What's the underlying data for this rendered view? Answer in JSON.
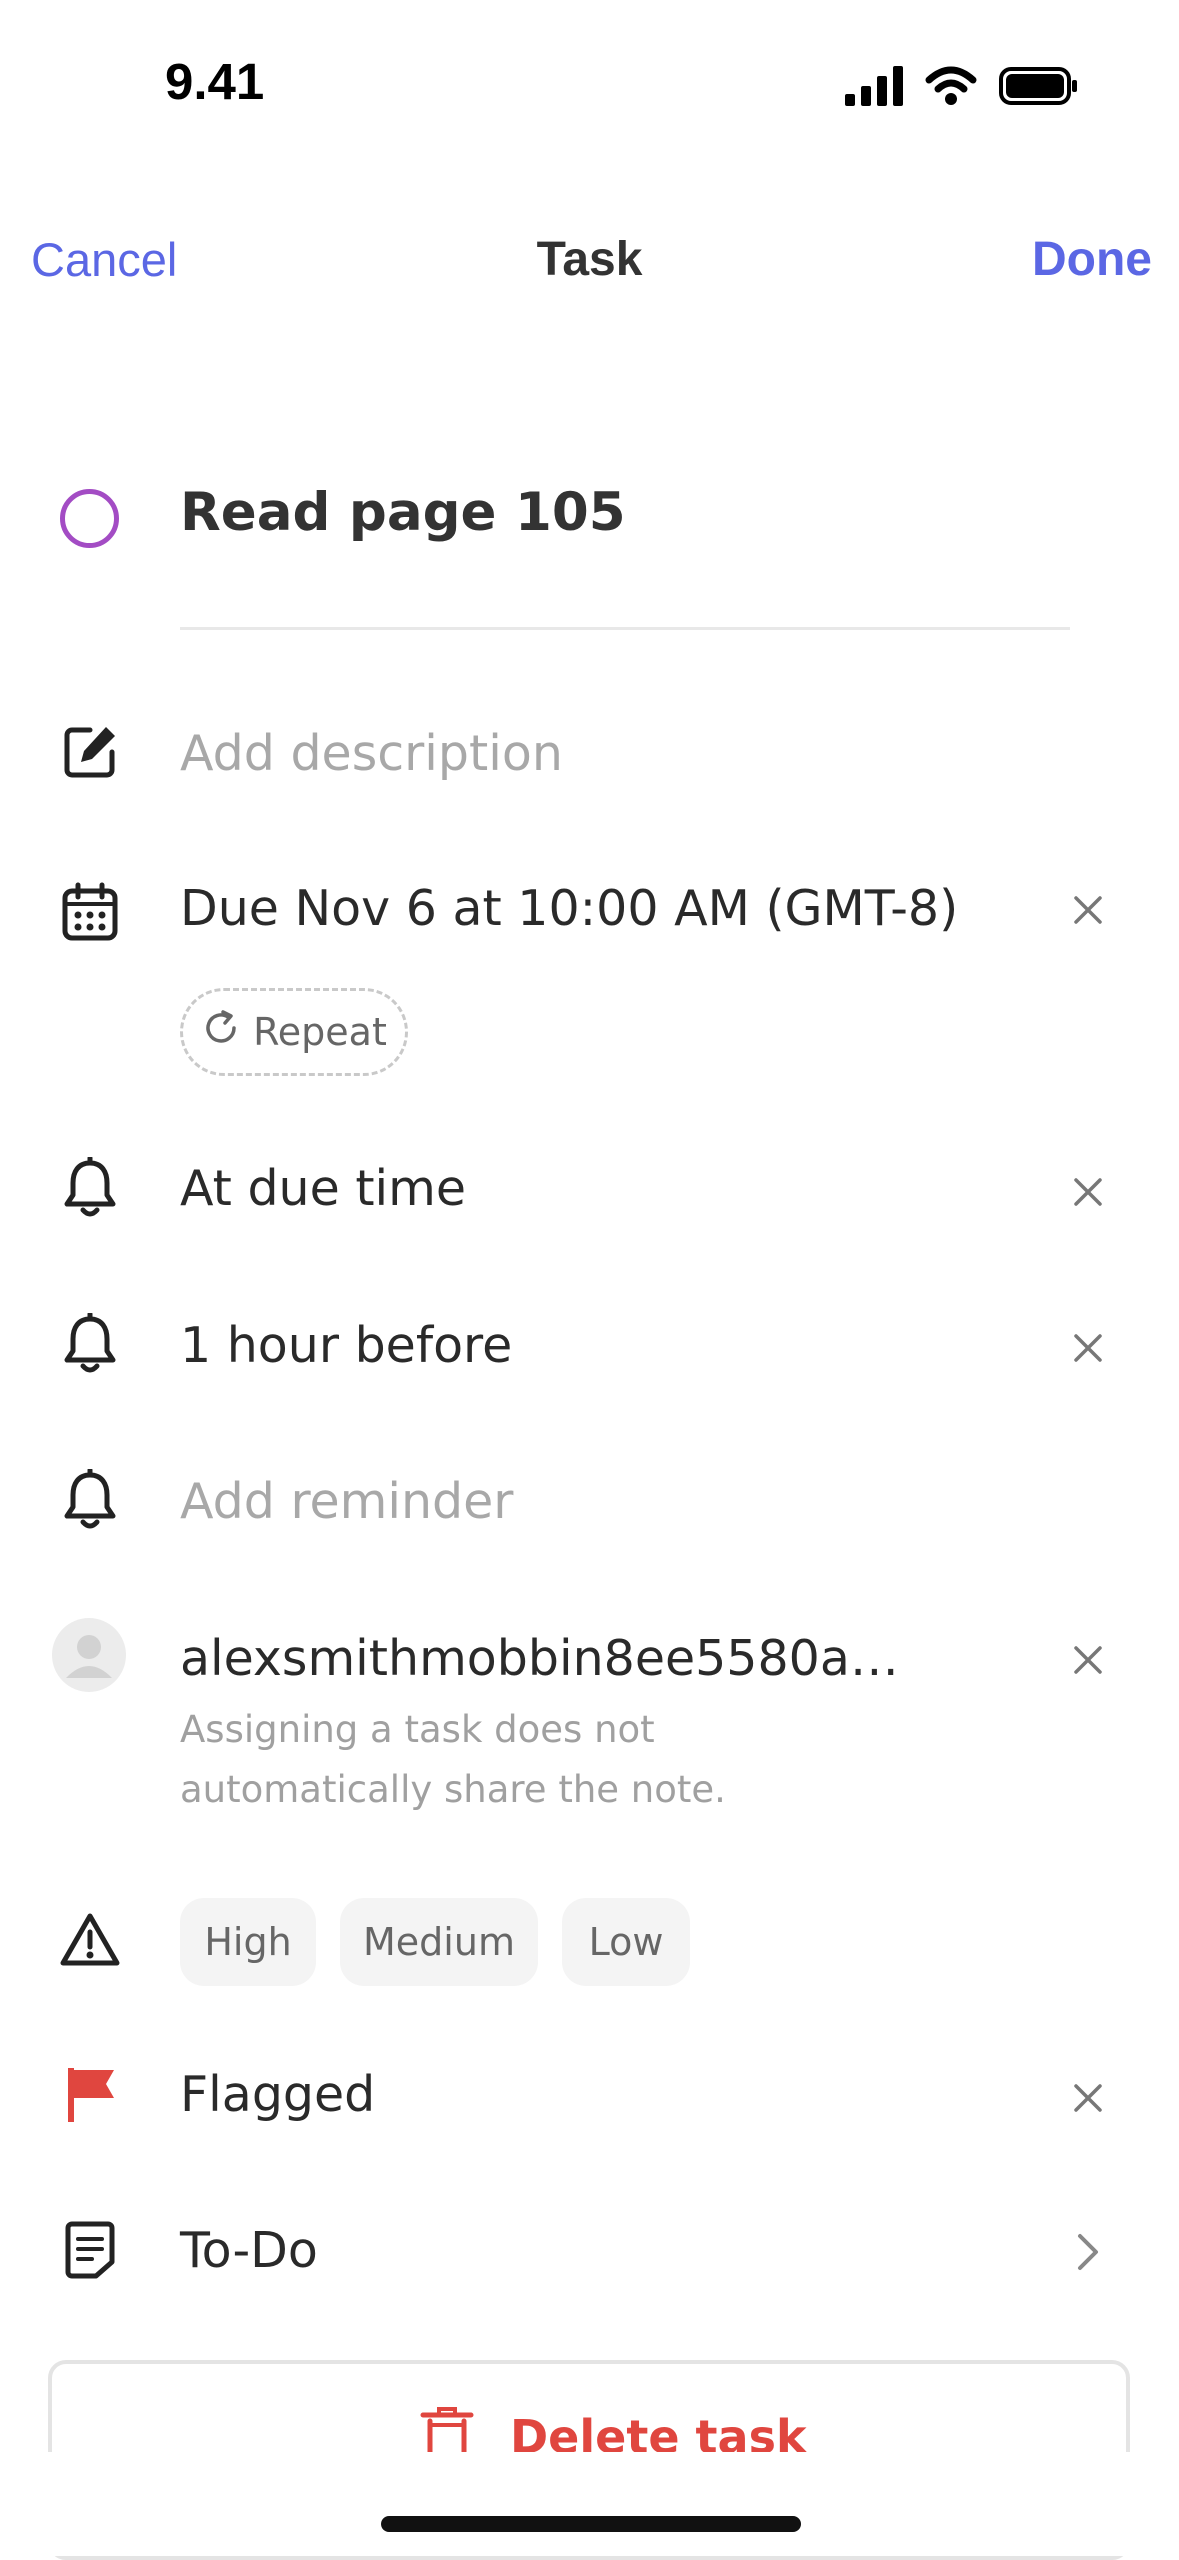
{
  "status_bar": {
    "time": "9.41"
  },
  "nav": {
    "cancel_label": "Cancel",
    "title": "Task",
    "done_label": "Done"
  },
  "task": {
    "title": "Read page 105",
    "check_color": "#a34cc4"
  },
  "description": {
    "placeholder": "Add description"
  },
  "due": {
    "text": "Due Nov 6 at 10:00 AM (GMT-8)",
    "repeat_label": "Repeat"
  },
  "reminders": [
    {
      "label": "At due time"
    },
    {
      "label": "1 hour before"
    }
  ],
  "add_reminder": {
    "placeholder": "Add reminder"
  },
  "assignee": {
    "name": "alexsmithmobbin8ee5580a…",
    "note": "Assigning a task does not automatically share the note."
  },
  "priority": {
    "options": [
      "High",
      "Medium",
      "Low"
    ]
  },
  "flag": {
    "label": "Flagged",
    "color": "#e0463f"
  },
  "list": {
    "label": "To-Do"
  },
  "delete": {
    "label": "Delete task",
    "color": "#e0463f"
  },
  "colors": {
    "accent": "#5b67e4"
  }
}
